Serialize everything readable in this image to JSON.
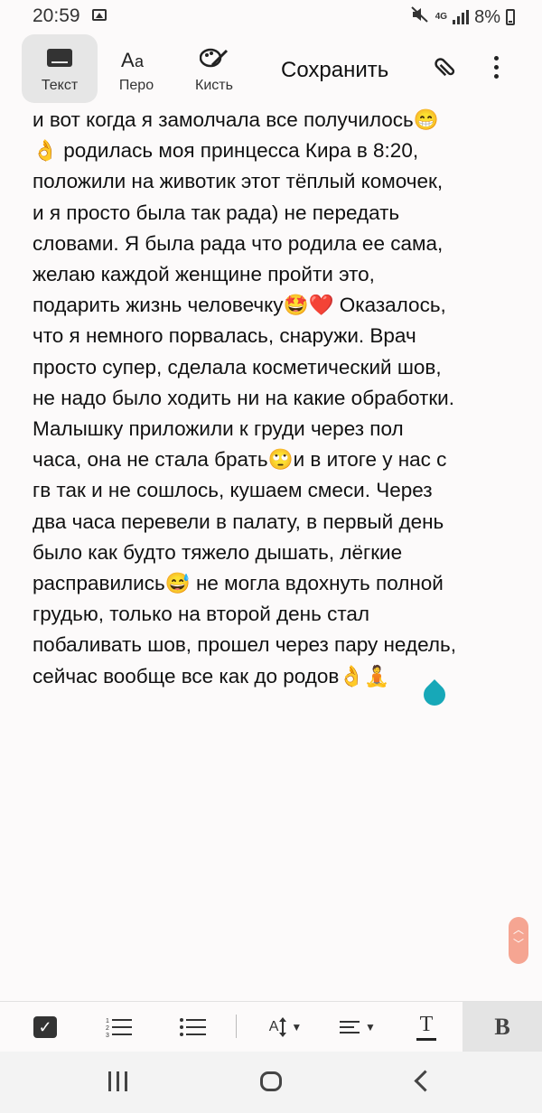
{
  "status": {
    "time": "20:59",
    "network": "4G",
    "battery": "8%",
    "icons": [
      "image-icon",
      "mute-icon",
      "signal-icon",
      "battery-icon"
    ]
  },
  "toolbar": {
    "text_label": "Текст",
    "pen_label": "Перо",
    "brush_label": "Кисть",
    "save_label": "Сохранить",
    "icons": [
      "keyboard-icon",
      "pen-icon",
      "brush-icon",
      "attach-icon",
      "more-icon"
    ]
  },
  "note": {
    "lines": [
      "и вот когда я замолчала  все получилось😁",
      "👌 родилась моя принцесса Кира в 8:20,",
      "положили на животик этот тёплый комочек,",
      "и я просто была так рада) не передать",
      "словами. Я была рада что родила ее сама,",
      "желаю каждой женщине пройти это,",
      "подарить  жизнь человечку🤩❤️ Оказалось,",
      "что я немного порвалась, снаружи. Врач",
      "просто супер, сделала косметический шов,",
      "не надо было ходить ни на какие обработки.",
      "Малышку приложили к груди  через пол",
      "часа, она не стала брать🙄и в итоге у нас с",
      "гв так и не сошлось, кушаем смеси. Через",
      "два часа перевели в палату, в первый день",
      "было как будто тяжело дышать, лёгкие",
      "расправились😅 не могла вдохнуть полной",
      "грудью, только на второй день стал",
      "побаливать шов, прошел через пару недель,",
      "сейчас вообще все как до родов👌🧘"
    ]
  },
  "format_bar": {
    "bold_label": "B",
    "text_style_glyph": "T",
    "font_size_glyph": "A"
  },
  "colors": {
    "cursor_drop": "#17a8b8",
    "scroll_handle": "#f5a592",
    "active_tab_bg": "#e6e6e6"
  }
}
